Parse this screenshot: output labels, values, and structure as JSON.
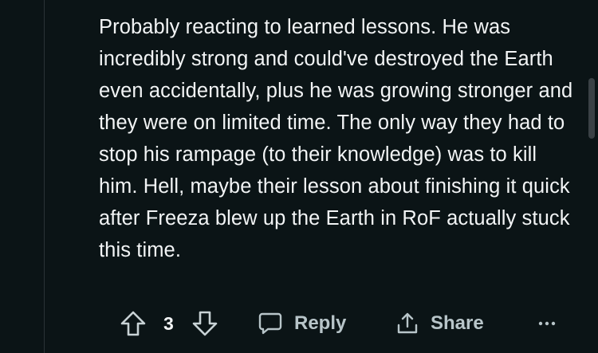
{
  "comment": {
    "text": "Probably reacting to learned lessons. He was incredibly strong and could've destroyed the Earth even accidentally, plus he was growing stronger and they were on limited time. The only way they had to stop his rampage (to their knowledge) was to kill him. Hell, maybe their lesson about finishing it quick after Freeza blew up the Earth in RoF actually stuck this time."
  },
  "actions": {
    "vote_count": "3",
    "reply_label": "Reply",
    "share_label": "Share"
  },
  "icons": {
    "upvote": "upvote-arrow-icon",
    "downvote": "downvote-arrow-icon",
    "reply": "speech-bubble-icon",
    "share": "share-icon",
    "more": "more-dots-icon"
  },
  "colors": {
    "background": "#0b1416",
    "text": "#f2f4f5",
    "action_text": "#b8c5c9"
  }
}
